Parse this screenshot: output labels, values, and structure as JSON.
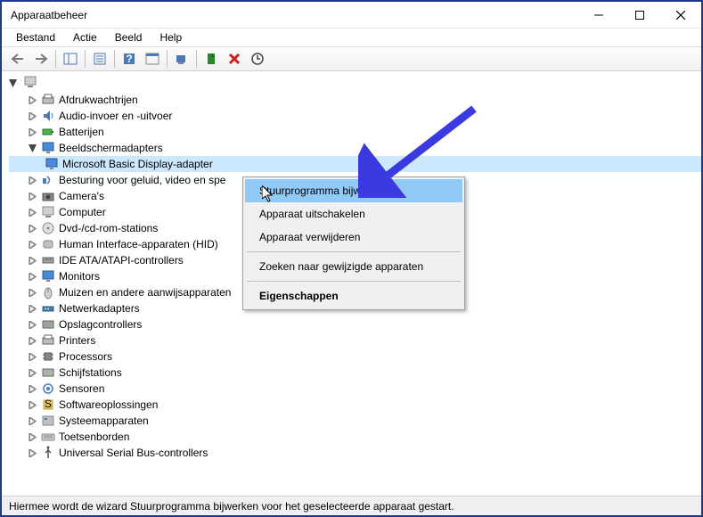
{
  "window": {
    "title": "Apparaatbeheer"
  },
  "menubar": {
    "items": [
      "Bestand",
      "Actie",
      "Beeld",
      "Help"
    ]
  },
  "tree": {
    "root_icon": "computer",
    "items": [
      {
        "label": "Afdrukwachtrijen",
        "icon": "printer",
        "expanded": false
      },
      {
        "label": "Audio-invoer en -uitvoer",
        "icon": "audio",
        "expanded": false
      },
      {
        "label": "Batterijen",
        "icon": "battery",
        "expanded": false
      },
      {
        "label": "Beeldschermadapters",
        "icon": "display",
        "expanded": true,
        "children": [
          {
            "label": "Microsoft Basic Display-adapter",
            "icon": "display",
            "selected": true
          }
        ]
      },
      {
        "label": "Besturing voor geluid, video en spe",
        "icon": "sound",
        "expanded": false
      },
      {
        "label": "Camera's",
        "icon": "camera",
        "expanded": false
      },
      {
        "label": "Computer",
        "icon": "computer",
        "expanded": false
      },
      {
        "label": "Dvd-/cd-rom-stations",
        "icon": "disc",
        "expanded": false
      },
      {
        "label": "Human Interface-apparaten (HID)",
        "icon": "hid",
        "expanded": false
      },
      {
        "label": "IDE ATA/ATAPI-controllers",
        "icon": "ide",
        "expanded": false
      },
      {
        "label": "Monitors",
        "icon": "monitor",
        "expanded": false
      },
      {
        "label": "Muizen en andere aanwijsapparaten",
        "icon": "mouse",
        "expanded": false
      },
      {
        "label": "Netwerkadapters",
        "icon": "network",
        "expanded": false
      },
      {
        "label": "Opslagcontrollers",
        "icon": "storage",
        "expanded": false
      },
      {
        "label": "Printers",
        "icon": "printer",
        "expanded": false
      },
      {
        "label": "Processors",
        "icon": "cpu",
        "expanded": false
      },
      {
        "label": "Schijfstations",
        "icon": "disk",
        "expanded": false
      },
      {
        "label": "Sensoren",
        "icon": "sensor",
        "expanded": false
      },
      {
        "label": "Softwareoplossingen",
        "icon": "software",
        "expanded": false
      },
      {
        "label": "Systeemapparaten",
        "icon": "system",
        "expanded": false
      },
      {
        "label": "Toetsenborden",
        "icon": "keyboard",
        "expanded": false
      },
      {
        "label": "Universal Serial Bus-controllers",
        "icon": "usb",
        "expanded": false
      }
    ]
  },
  "context_menu": {
    "items": [
      {
        "label": "Stuurprogramma bijwerken",
        "highlighted": true
      },
      {
        "label": "Apparaat uitschakelen",
        "highlighted": false
      },
      {
        "label": "Apparaat verwijderen",
        "highlighted": false
      },
      {
        "separator": true
      },
      {
        "label": "Zoeken naar gewijzigde apparaten",
        "highlighted": false
      },
      {
        "separator": true
      },
      {
        "label": "Eigenschappen",
        "highlighted": false,
        "bold": true
      }
    ]
  },
  "statusbar": {
    "text": "Hiermee wordt de wizard Stuurprogramma bijwerken voor het geselecteerde apparaat gestart."
  }
}
